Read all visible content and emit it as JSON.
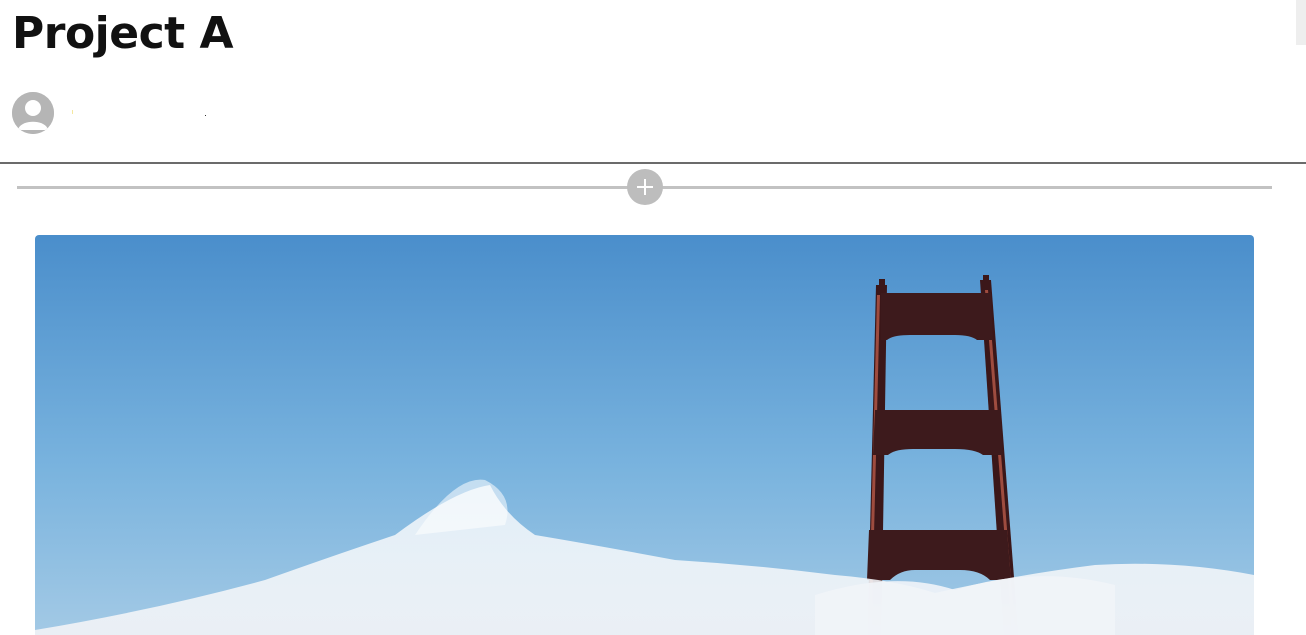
{
  "post": {
    "title": "Project A",
    "author": {
      "name": "",
      "avatar_icon": "user-avatar-icon"
    }
  },
  "editor": {
    "insert_block_icon": "plus-icon"
  },
  "hero_image": {
    "subject": "bridge-tower-in-fog",
    "sky_color": "#4a90cc",
    "tower_color": "#3d1a1c"
  }
}
